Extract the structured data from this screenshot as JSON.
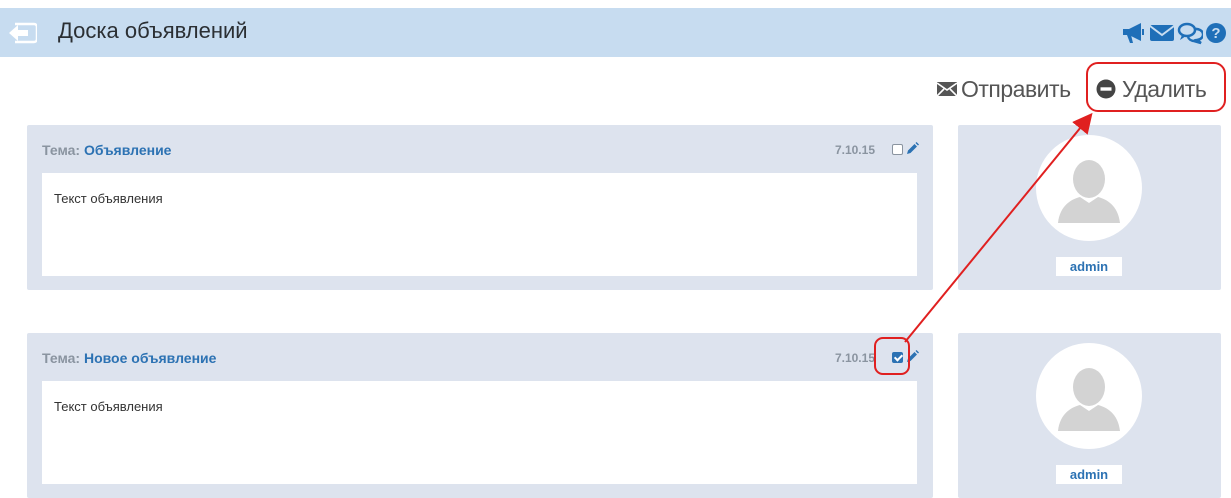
{
  "header": {
    "title": "Доска объявлений",
    "back_icon": "back-arrow-icon",
    "icons": [
      "megaphone-icon",
      "envelope-icon",
      "chat-icon",
      "help-icon"
    ]
  },
  "toolbar": {
    "send_label": "Отправить",
    "delete_label": "Удалить"
  },
  "posts": [
    {
      "subject_label": "Тема:",
      "subject": "Объявление",
      "date": "7.10.15",
      "checked": false,
      "body": "Текст объявления",
      "author": "admin"
    },
    {
      "subject_label": "Тема:",
      "subject": "Новое объявление",
      "date": "7.10.15",
      "checked": true,
      "body": "Текст объявления",
      "author": "admin"
    }
  ],
  "colors": {
    "header_bg": "#c7dcf0",
    "accent": "#2c72b3",
    "panel_bg": "#dde3ee",
    "annotation": "#e02020"
  }
}
